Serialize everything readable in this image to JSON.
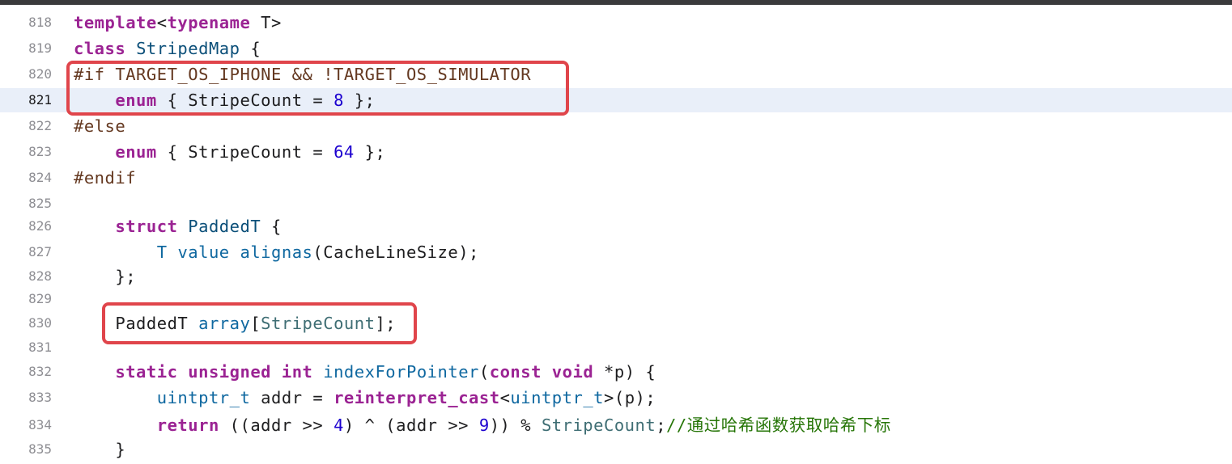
{
  "window": {
    "accent_color": "#e0454b",
    "current_line_bg": "#e9eff9"
  },
  "editor": {
    "current_line": "821",
    "lines": [
      {
        "num": "818",
        "tokens": [
          [
            "k",
            "template"
          ],
          [
            "",
            "<"
          ],
          [
            "k",
            "typename"
          ],
          [
            "",
            " T>"
          ]
        ]
      },
      {
        "num": "819",
        "tokens": [
          [
            "k",
            "class"
          ],
          [
            "",
            " "
          ],
          [
            "t",
            "StripedMap"
          ],
          [
            "",
            " {"
          ]
        ]
      },
      {
        "num": "820",
        "tokens": [
          [
            "pp",
            "#if TARGET_OS_IPHONE && !TARGET_OS_SIMULATOR"
          ]
        ]
      },
      {
        "num": "821",
        "tokens": [
          [
            "",
            "    "
          ],
          [
            "k",
            "enum"
          ],
          [
            "",
            " { StripeCount = "
          ],
          [
            "n",
            "8"
          ],
          [
            "",
            " };"
          ]
        ]
      },
      {
        "num": "822",
        "tokens": [
          [
            "pp",
            "#else"
          ]
        ]
      },
      {
        "num": "823",
        "tokens": [
          [
            "",
            "    "
          ],
          [
            "k",
            "enum"
          ],
          [
            "",
            " { StripeCount = "
          ],
          [
            "n",
            "64"
          ],
          [
            "",
            " };"
          ]
        ]
      },
      {
        "num": "824",
        "tokens": [
          [
            "pp",
            "#endif"
          ]
        ]
      },
      {
        "num": "825",
        "tokens": []
      },
      {
        "num": "826",
        "tokens": [
          [
            "",
            "    "
          ],
          [
            "k",
            "struct"
          ],
          [
            "",
            " "
          ],
          [
            "t",
            "PaddedT"
          ],
          [
            "",
            " {"
          ]
        ]
      },
      {
        "num": "827",
        "tokens": [
          [
            "",
            "        "
          ],
          [
            "fc",
            "T"
          ],
          [
            "",
            " "
          ],
          [
            "fc",
            "value"
          ],
          [
            "",
            " "
          ],
          [
            "fc",
            "alignas"
          ],
          [
            "",
            "(CacheLineSize);"
          ]
        ]
      },
      {
        "num": "828",
        "tokens": [
          [
            "",
            "    };"
          ]
        ]
      },
      {
        "num": "829",
        "tokens": []
      },
      {
        "num": "830",
        "tokens": [
          [
            "",
            "    PaddedT "
          ],
          [
            "fc",
            "array"
          ],
          [
            "",
            "["
          ],
          [
            "var",
            "StripeCount"
          ],
          [
            "",
            "];"
          ]
        ]
      },
      {
        "num": "831",
        "tokens": []
      },
      {
        "num": "832",
        "tokens": [
          [
            "",
            "    "
          ],
          [
            "k",
            "static"
          ],
          [
            "",
            " "
          ],
          [
            "k",
            "unsigned"
          ],
          [
            "",
            " "
          ],
          [
            "k",
            "int"
          ],
          [
            "",
            " "
          ],
          [
            "fc",
            "indexForPointer"
          ],
          [
            "",
            "("
          ],
          [
            "k",
            "const"
          ],
          [
            "",
            " "
          ],
          [
            "k",
            "void"
          ],
          [
            "",
            " *p) {"
          ]
        ]
      },
      {
        "num": "833",
        "tokens": [
          [
            "",
            "        "
          ],
          [
            "fc",
            "uintptr_t"
          ],
          [
            "",
            " addr = "
          ],
          [
            "k",
            "reinterpret_cast"
          ],
          [
            "",
            "<"
          ],
          [
            "fc",
            "uintptr_t"
          ],
          [
            "",
            ">(p);"
          ]
        ]
      },
      {
        "num": "834",
        "tokens": [
          [
            "",
            "        "
          ],
          [
            "k",
            "return"
          ],
          [
            "",
            " ((addr >> "
          ],
          [
            "n",
            "4"
          ],
          [
            "",
            ") ^ (addr >> "
          ],
          [
            "n",
            "9"
          ],
          [
            "",
            ")) % "
          ],
          [
            "var",
            "StripeCount"
          ],
          [
            "",
            ";"
          ],
          [
            "cm",
            "//通过哈希函数获取哈希下标"
          ]
        ]
      },
      {
        "num": "835",
        "tokens": [
          [
            "",
            "    }"
          ]
        ]
      }
    ]
  }
}
